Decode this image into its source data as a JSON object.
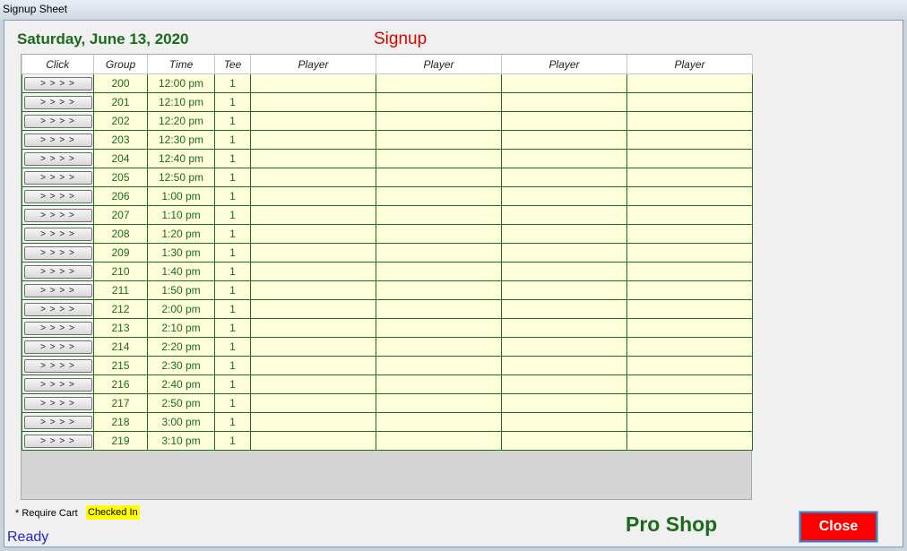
{
  "window": {
    "title": "Signup Sheet"
  },
  "header": {
    "date": "Saturday, June 13, 2020",
    "heading": "Signup"
  },
  "table": {
    "columns": [
      "Click",
      "Group",
      "Time",
      "Tee",
      "Player",
      "Player",
      "Player",
      "Player"
    ],
    "button_label": "> > > >",
    "rows": [
      {
        "group": "200",
        "time": "12:00 pm",
        "tee": "1"
      },
      {
        "group": "201",
        "time": "12:10 pm",
        "tee": "1"
      },
      {
        "group": "202",
        "time": "12:20 pm",
        "tee": "1"
      },
      {
        "group": "203",
        "time": "12:30 pm",
        "tee": "1"
      },
      {
        "group": "204",
        "time": "12:40 pm",
        "tee": "1"
      },
      {
        "group": "205",
        "time": "12:50 pm",
        "tee": "1"
      },
      {
        "group": "206",
        "time": "1:00 pm",
        "tee": "1"
      },
      {
        "group": "207",
        "time": "1:10 pm",
        "tee": "1"
      },
      {
        "group": "208",
        "time": "1:20 pm",
        "tee": "1"
      },
      {
        "group": "209",
        "time": "1:30 pm",
        "tee": "1"
      },
      {
        "group": "210",
        "time": "1:40 pm",
        "tee": "1"
      },
      {
        "group": "211",
        "time": "1:50 pm",
        "tee": "1"
      },
      {
        "group": "212",
        "time": "2:00 pm",
        "tee": "1"
      },
      {
        "group": "213",
        "time": "2:10 pm",
        "tee": "1"
      },
      {
        "group": "214",
        "time": "2:20 pm",
        "tee": "1"
      },
      {
        "group": "215",
        "time": "2:30 pm",
        "tee": "1"
      },
      {
        "group": "216",
        "time": "2:40 pm",
        "tee": "1"
      },
      {
        "group": "217",
        "time": "2:50 pm",
        "tee": "1"
      },
      {
        "group": "218",
        "time": "3:00 pm",
        "tee": "1"
      },
      {
        "group": "219",
        "time": "3:10 pm",
        "tee": "1"
      }
    ]
  },
  "legend": {
    "require_cart": "* Require Cart",
    "checked_in": "Checked In"
  },
  "status": "Ready",
  "footer": {
    "location": "Pro Shop",
    "close_label": "Close"
  },
  "colors": {
    "date_text": "#1a6b1a",
    "heading_text": "#e00000",
    "row_background": "#ffffdc",
    "grid_line": "#1e6e1e",
    "checked_in_highlight": "#ffff00",
    "close_button": "#ff0000",
    "status_text": "#2424d0"
  }
}
